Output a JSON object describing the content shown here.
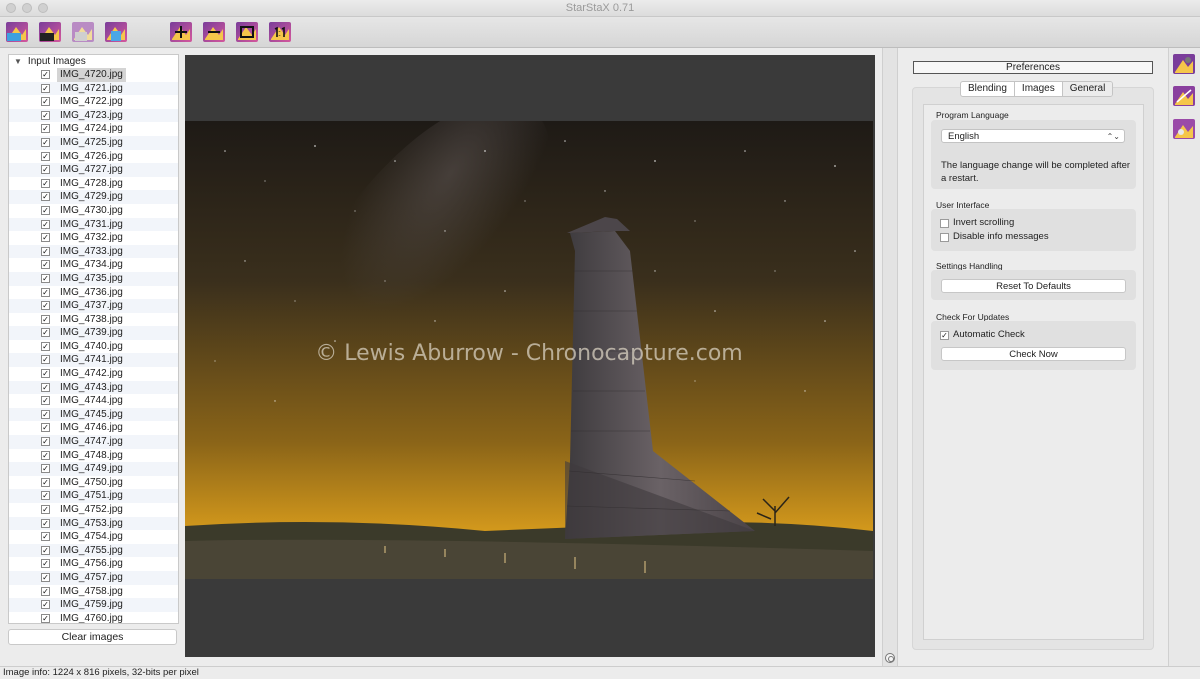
{
  "window": {
    "title": "StarStaX 0.71"
  },
  "toolbar": {
    "buttons": [
      {
        "icon": "open-images-icon"
      },
      {
        "icon": "open-dark-frames-icon"
      },
      {
        "icon": "save-image-icon"
      },
      {
        "icon": "start-processing-icon"
      },
      {
        "icon": "zoom-in-icon"
      },
      {
        "icon": "zoom-out-icon"
      },
      {
        "icon": "fit-to-window-icon"
      },
      {
        "icon": "actual-size-icon"
      }
    ]
  },
  "files": {
    "header": "Input Images",
    "items": [
      "IMG_4720.jpg",
      "IMG_4721.jpg",
      "IMG_4722.jpg",
      "IMG_4723.jpg",
      "IMG_4724.jpg",
      "IMG_4725.jpg",
      "IMG_4726.jpg",
      "IMG_4727.jpg",
      "IMG_4728.jpg",
      "IMG_4729.jpg",
      "IMG_4730.jpg",
      "IMG_4731.jpg",
      "IMG_4732.jpg",
      "IMG_4733.jpg",
      "IMG_4734.jpg",
      "IMG_4735.jpg",
      "IMG_4736.jpg",
      "IMG_4737.jpg",
      "IMG_4738.jpg",
      "IMG_4739.jpg",
      "IMG_4740.jpg",
      "IMG_4741.jpg",
      "IMG_4742.jpg",
      "IMG_4743.jpg",
      "IMG_4744.jpg",
      "IMG_4745.jpg",
      "IMG_4746.jpg",
      "IMG_4747.jpg",
      "IMG_4748.jpg",
      "IMG_4749.jpg",
      "IMG_4750.jpg",
      "IMG_4751.jpg",
      "IMG_4752.jpg",
      "IMG_4753.jpg",
      "IMG_4754.jpg",
      "IMG_4755.jpg",
      "IMG_4756.jpg",
      "IMG_4757.jpg",
      "IMG_4758.jpg",
      "IMG_4759.jpg",
      "IMG_4760.jpg"
    ],
    "checkmark": "✓",
    "clear_button": "Clear images"
  },
  "viewer": {
    "watermark": "© Lewis Aburrow - Chronocapture.com"
  },
  "preferences": {
    "title": "Preferences",
    "tabs": [
      "Blending",
      "Images",
      "General"
    ],
    "active_tab": "General",
    "program_language": {
      "title": "Program Language",
      "selected": "English",
      "arrow": "⌃⌄",
      "note": "The language change will be completed after a restart."
    },
    "user_interface": {
      "title": "User Interface",
      "invert_scrolling": "Invert scrolling",
      "disable_info": "Disable info messages"
    },
    "settings_handling": {
      "title": "Settings Handling",
      "reset_button": "Reset To Defaults"
    },
    "updates": {
      "title": "Check For Updates",
      "automatic_check": "Automatic Check",
      "check": "✓",
      "check_now_button": "Check Now"
    }
  },
  "right_toolbar": {
    "buttons": [
      {
        "icon": "preferences-icon"
      },
      {
        "icon": "blend-mode-icon"
      },
      {
        "icon": "effects-icon"
      }
    ]
  },
  "status": {
    "text": "Image info: 1224 x 816 pixels, 32-bits per pixel"
  }
}
